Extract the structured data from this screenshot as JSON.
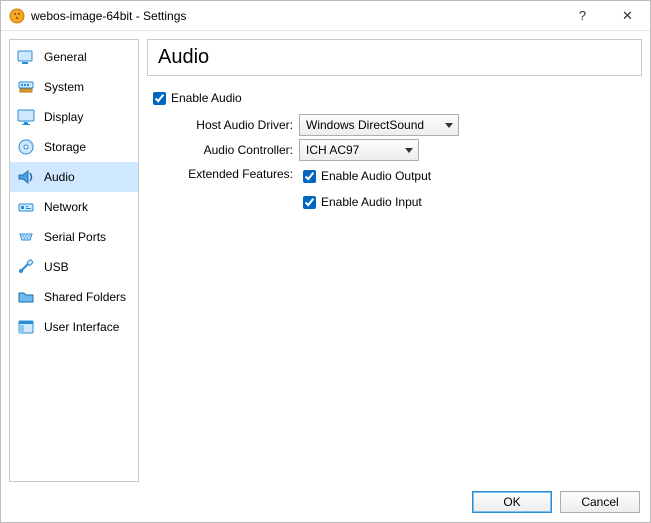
{
  "window": {
    "title": "webos-image-64bit - Settings",
    "help_symbol": "?",
    "close_symbol": "✕"
  },
  "sidebar": {
    "items": [
      {
        "label": "General"
      },
      {
        "label": "System"
      },
      {
        "label": "Display"
      },
      {
        "label": "Storage"
      },
      {
        "label": "Audio"
      },
      {
        "label": "Network"
      },
      {
        "label": "Serial Ports"
      },
      {
        "label": "USB"
      },
      {
        "label": "Shared Folders"
      },
      {
        "label": "User Interface"
      }
    ],
    "selected_index": 4
  },
  "main": {
    "section_title": "Audio",
    "enable_audio": {
      "label": "Enable Audio",
      "checked": true
    },
    "host_audio_driver": {
      "label": "Host Audio Driver:",
      "value": "Windows DirectSound"
    },
    "audio_controller": {
      "label": "Audio Controller:",
      "value": "ICH AC97"
    },
    "extended_features": {
      "label": "Extended Features:",
      "output": {
        "label": "Enable Audio Output",
        "checked": true
      },
      "input": {
        "label": "Enable Audio Input",
        "checked": true
      }
    }
  },
  "footer": {
    "ok": "OK",
    "cancel": "Cancel"
  }
}
